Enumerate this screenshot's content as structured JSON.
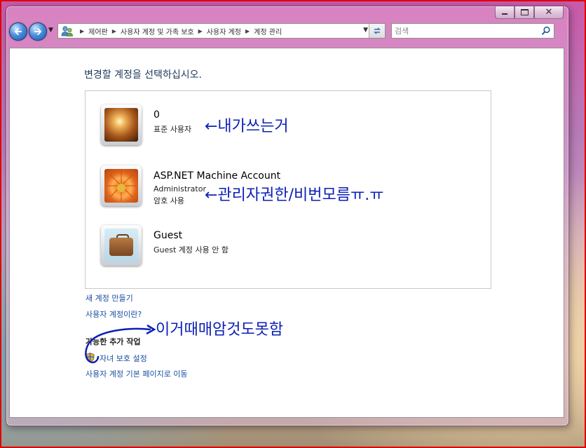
{
  "window": {
    "caption": {
      "minimize": "minimize",
      "maximize": "maximize",
      "close": "close"
    }
  },
  "toolbar": {
    "breadcrumbs": [
      "제어판",
      "사용자 계정 및 가족 보호",
      "사용자 계정",
      "계정 관리"
    ],
    "search_placeholder": "검색"
  },
  "main": {
    "title": "변경할 계정을 선택하십시오.",
    "accounts": [
      {
        "name": "0",
        "lines": [
          "표준 사용자"
        ],
        "avatar": "sparks-picture"
      },
      {
        "name": "ASP.NET Machine Account",
        "lines": [
          "Administrator",
          "암호 사용"
        ],
        "avatar": "flower-picture"
      },
      {
        "name": "Guest",
        "lines": [
          "Guest 계정 사용 안 함"
        ],
        "avatar": "suitcase-picture"
      }
    ],
    "links": {
      "create_account": "새 계정 만들기",
      "what_is_account": "사용자 계정이란?"
    },
    "additional": {
      "heading": "가능한 추가 작업",
      "parental_controls": "자녀 보호 설정",
      "go_main_page": "사용자 계정 기본 페이지로 이동"
    }
  },
  "annotations": {
    "note1": "←내가쓰는거",
    "note2": "←관리자권한/비번모름ㅠ.ㅠ",
    "note3": "이거때매암것도못함"
  },
  "colors": {
    "link": "#1a4fa3",
    "title": "#1e395b",
    "annotation_ink": "#0b1fb4",
    "highlight_border": "#e00000"
  }
}
